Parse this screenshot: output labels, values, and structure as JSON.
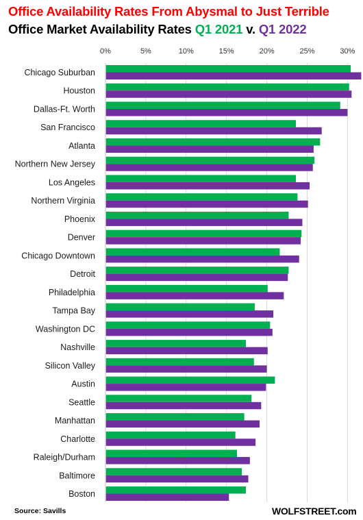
{
  "header": {
    "title": "Office Availability  Rates From Abysmal to Just Terrible",
    "subtitle_prefix": "Office Market  Availability  Rates ",
    "subtitle_series1": "Q1 2021",
    "subtitle_mid": " v. ",
    "subtitle_series2": "Q1 2022"
  },
  "footer": {
    "source": "Source: Savills",
    "brand": "WOLFSTREET.com"
  },
  "chart_data": {
    "type": "bar",
    "orientation": "horizontal",
    "title": "Office Availability Rates From Abysmal to Just Terrible",
    "subtitle": "Office Market Availability Rates Q1 2021 v. Q1 2022",
    "xlabel": "",
    "ylabel": "",
    "xlim": [
      0,
      31
    ],
    "x_ticks": [
      0,
      5,
      10,
      15,
      20,
      25,
      30
    ],
    "x_tick_labels": [
      "0%",
      "5%",
      "10%",
      "15%",
      "20%",
      "25%",
      "30%"
    ],
    "x_axis_position": "top",
    "grid": true,
    "legend": "in subtitle",
    "categories": [
      "Chicago Suburban",
      "Houston",
      "Dallas-Ft. Worth",
      "San Francisco",
      "Atlanta",
      "Northern New Jersey",
      "Los Angeles",
      "Northern Virginia",
      "Phoenix",
      "Denver",
      "Chicago Downtown",
      "Detroit",
      "Philadelphia",
      "Tampa Bay",
      "Washington DC",
      "Nashville",
      "Silicon Valley",
      "Austin",
      "Seattle",
      "Manhattan",
      "Charlotte",
      "Raleigh/Durham",
      "Baltimore",
      "Boston"
    ],
    "series": [
      {
        "name": "Q1 2021",
        "color": "#00b050",
        "values": [
          30.4,
          30.2,
          29.1,
          23.6,
          26.6,
          25.9,
          23.6,
          23.8,
          22.7,
          24.3,
          21.6,
          22.7,
          20.1,
          18.5,
          20.4,
          17.4,
          18.4,
          21.0,
          18.1,
          17.2,
          16.1,
          16.3,
          16.9,
          17.4
        ]
      },
      {
        "name": "Q1 2022",
        "color": "#7030a0",
        "values": [
          31.7,
          30.5,
          30.0,
          26.8,
          25.8,
          25.7,
          25.3,
          25.1,
          24.4,
          24.2,
          24.0,
          22.6,
          22.1,
          20.8,
          20.7,
          20.1,
          20.0,
          19.9,
          19.3,
          19.1,
          18.6,
          17.9,
          17.7,
          15.3
        ]
      }
    ]
  }
}
